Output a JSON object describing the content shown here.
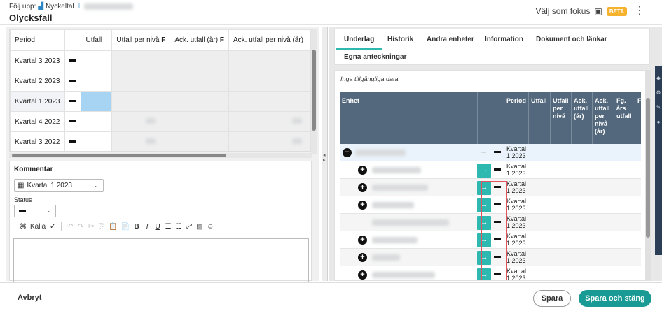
{
  "header": {
    "follow_label": "Följ upp:",
    "kpi_label": "Nyckeltal",
    "title": "Olycksfall",
    "focus_label": "Välj som fokus",
    "beta_badge": "BETA"
  },
  "grid": {
    "columns": [
      "Period",
      "",
      "Utfall",
      "Utfall per nivå",
      "Ack. utfall (år)",
      "Ack. utfall per nivå (år)"
    ],
    "rows": [
      {
        "period": "Kvartal 3 2023"
      },
      {
        "period": "Kvartal 2 2023"
      },
      {
        "period": "Kvartal 1 2023"
      },
      {
        "period": "Kvartal 4 2022"
      },
      {
        "period": "Kvartal 3 2022"
      }
    ]
  },
  "comment": {
    "label": "Kommentar",
    "period_select": "Kvartal 1 2023",
    "status_label": "Status",
    "toolbar_source": "Källa"
  },
  "tabs": [
    "Underlag",
    "Historik",
    "Andra enheter",
    "Information",
    "Dokument och länkar",
    "Egna anteckningar"
  ],
  "underlag": {
    "no_data": "Inga tillgängliga data",
    "columns": [
      "Enhet",
      "Period",
      "Utfall",
      "Utfall per nivå",
      "Ack. utfall (år)",
      "Ack. utfall per nivå (år)",
      "Fg. års utfall",
      "F"
    ],
    "row_period": [
      "Kvartal",
      "1 2023"
    ]
  },
  "footer": {
    "cancel": "Avbryt",
    "save": "Spara",
    "save_close": "Spara och stäng"
  },
  "colors": {
    "accent": "#2db8b0",
    "save_close_bg": "#1a9a94",
    "table_header": "#53687d",
    "selected_cell": "#a8d4f4",
    "beta": "#f6b12d",
    "highlight_box": "#e0525e"
  }
}
